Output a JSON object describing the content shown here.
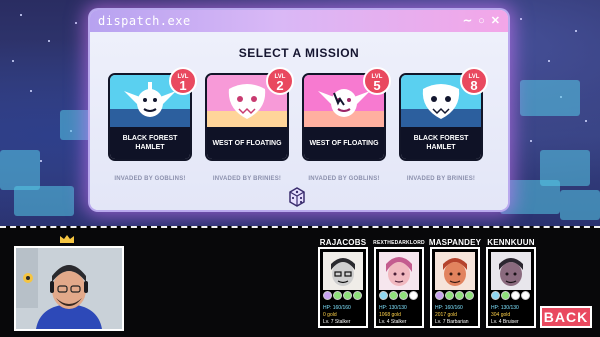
{
  "window": {
    "title": "dispatch.exe"
  },
  "mission_select": {
    "heading": "SELECT A MISSION",
    "missions": [
      {
        "level_label": "LVL",
        "level": "1",
        "name": "BLACK FOREST HAMLET",
        "subtitle": "INVADED BY GOBLINS!",
        "art_colors": [
          "#5ad0f0",
          "#2c5f9e"
        ]
      },
      {
        "level_label": "LVL",
        "level": "2",
        "name": "WEST OF FLOATING",
        "subtitle": "INVADED BY BRINIES!",
        "art_colors": [
          "#f79ad8",
          "#ffd59a"
        ]
      },
      {
        "level_label": "LVL",
        "level": "5",
        "name": "WEST OF FLOATING",
        "subtitle": "INVADED BY GOBLINS!",
        "art_colors": [
          "#f77ad0",
          "#ffb0a0"
        ]
      },
      {
        "level_label": "LVL",
        "level": "8",
        "name": "BLACK FOREST HAMLET",
        "subtitle": "INVADED BY BRINIES!",
        "art_colors": [
          "#5ad0f0",
          "#2c5f9e"
        ]
      }
    ]
  },
  "party": [
    {
      "name": "RAJACOBS",
      "hp": "HP: 160/160",
      "gold": "0 gold",
      "level": "Lv. 7 Stalker",
      "portrait_bg": "#f0ede8",
      "hair": "#2a2a2e",
      "skin": "#cfcfcf"
    },
    {
      "name": "REXTHEDARKLORD",
      "hp": "HP: 130/130",
      "gold": "1068 gold",
      "level": "Lv. 4 Stalker",
      "portrait_bg": "#f6e6ee",
      "hair": "#c45c8f",
      "skin": "#f1b9c0"
    },
    {
      "name": "MASPANDEY",
      "hp": "HP: 160/160",
      "gold": "2017 gold",
      "level": "Lv. 7 Barbarian",
      "portrait_bg": "#f6e4da",
      "hair": "#b5432c",
      "skin": "#e2835e"
    },
    {
      "name": "KENNKUUN",
      "hp": "HP: 130/130",
      "gold": "304 gold",
      "level": "Lv. 4 Bruiser",
      "portrait_bg": "#e8e6ec",
      "hair": "#2b2630",
      "skin": "#8a6a7e"
    }
  ],
  "controls": {
    "back_label": "BACK"
  },
  "colors": {
    "accent": "#e9495f",
    "window_glow": "#dc78ff",
    "hud_bg": "#08080a"
  }
}
